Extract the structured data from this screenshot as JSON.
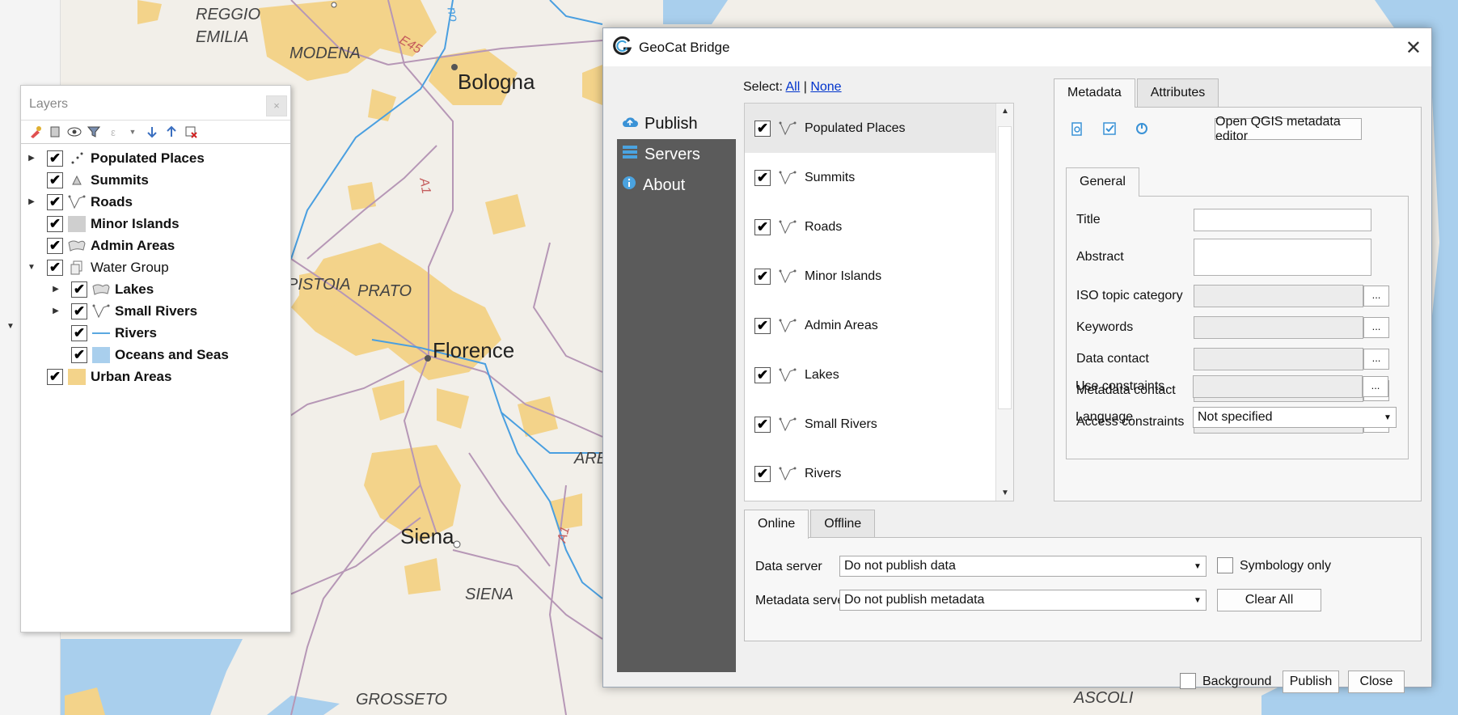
{
  "map": {
    "labels": [
      {
        "text": "REGGIO",
        "style": "it"
      },
      {
        "text": "EMILIA",
        "style": "it"
      },
      {
        "text": "MODENA",
        "style": "it"
      },
      {
        "text": "E45",
        "style": "road"
      },
      {
        "text": "Bologna",
        "style": "city"
      },
      {
        "text": "A1",
        "style": "road"
      },
      {
        "text": "PISTOIA",
        "style": "it"
      },
      {
        "text": "PRATO",
        "style": "it"
      },
      {
        "text": "Florence",
        "style": "city"
      },
      {
        "text": "AREZ",
        "style": "it"
      },
      {
        "text": "Siena",
        "style": "city"
      },
      {
        "text": "A1",
        "style": "road"
      },
      {
        "text": "SIENA",
        "style": "it"
      },
      {
        "text": "GROSSETO",
        "style": "it"
      },
      {
        "text": "ASCOLI",
        "style": "it"
      },
      {
        "text": "no",
        "style": "road"
      }
    ],
    "colors": {
      "land": "#f2efe9",
      "urban": "#f3d38a",
      "sea": "#a9cfed",
      "roads": "#b697b6",
      "rivers": "#4a9fe0"
    }
  },
  "layers_panel": {
    "title": "Layers",
    "close_label": "×",
    "toolbar_icons": [
      "style-manager-icon",
      "add-group-icon",
      "visibility-icon",
      "filter-icon",
      "expression-filter-icon",
      "expand-all-icon",
      "collapse-all-icon",
      "remove-layer-icon"
    ],
    "items": [
      {
        "name": "Populated Places",
        "expand": "▶",
        "symbol": "points",
        "bold": true,
        "checked": "✔"
      },
      {
        "name": "Summits",
        "expand": "",
        "symbol": "triangle",
        "bold": true,
        "checked": "✔"
      },
      {
        "name": "Roads",
        "expand": "▶",
        "symbol": "line",
        "bold": true,
        "checked": "✔"
      },
      {
        "name": "Minor Islands",
        "expand": "",
        "symbol": "grey-fill",
        "bold": true,
        "checked": "✔"
      },
      {
        "name": "Admin Areas",
        "expand": "",
        "symbol": "polygon",
        "bold": true,
        "checked": "✔"
      },
      {
        "name": "Water Group",
        "expand": "▼",
        "symbol": "group",
        "bold": false,
        "checked": "✔"
      },
      {
        "name": "Lakes",
        "expand": "▶",
        "symbol": "polygon",
        "bold": true,
        "checked": "✔",
        "indent": 1
      },
      {
        "name": "Small Rivers",
        "expand": "▶",
        "symbol": "line",
        "bold": true,
        "checked": "✔",
        "indent": 1
      },
      {
        "name": "Rivers",
        "expand": "",
        "symbol": "blue-line",
        "bold": true,
        "checked": "✔",
        "indent": 1
      },
      {
        "name": "Oceans and Seas",
        "expand": "",
        "symbol": "blue-fill",
        "bold": true,
        "checked": "✔",
        "indent": 1
      },
      {
        "name": "Urban Areas",
        "expand": "",
        "symbol": "yellow-fill",
        "bold": true,
        "checked": "✔"
      }
    ]
  },
  "bridge": {
    "title": "GeoCat Bridge",
    "close_label": "✕",
    "nav": [
      {
        "label": "Publish",
        "icon": "cloud-upload-icon",
        "active": true
      },
      {
        "label": "Servers",
        "icon": "servers-icon",
        "active": false
      },
      {
        "label": "About",
        "icon": "info-icon",
        "active": false
      }
    ],
    "select": {
      "prefix": "Select:",
      "all": "All",
      "separator": "|",
      "none": "None"
    },
    "layer_list": [
      {
        "name": "Populated Places",
        "checked": "✔"
      },
      {
        "name": "Summits",
        "checked": "✔"
      },
      {
        "name": "Roads",
        "checked": "✔"
      },
      {
        "name": "Minor Islands",
        "checked": "✔"
      },
      {
        "name": "Admin Areas",
        "checked": "✔"
      },
      {
        "name": "Lakes",
        "checked": "✔"
      },
      {
        "name": "Small Rivers",
        "checked": "✔"
      },
      {
        "name": "Rivers",
        "checked": "✔"
      }
    ],
    "meta_tabs": [
      "Metadata",
      "Attributes"
    ],
    "meta_icons": [
      "load-metadata-icon",
      "validate-metadata-icon",
      "preview-metadata-icon"
    ],
    "open_editor": "Open QGIS metadata editor",
    "general_tab": "General",
    "fields": {
      "title": "Title",
      "abstract": "Abstract",
      "iso": "ISO topic category",
      "keywords": "Keywords",
      "data_contact": "Data contact",
      "metadata_contact": "Metadata contact",
      "access": "Access constraints",
      "use": "Use constraints",
      "language": "Language"
    },
    "dots": "...",
    "language_value": "Not specified",
    "server_tabs": [
      "Online",
      "Offline"
    ],
    "data_server_label": "Data server",
    "data_server_value": "Do not publish data",
    "symbology_only": "Symbology only",
    "metadata_server_label": "Metadata server",
    "metadata_server_value": "Do not publish metadata",
    "clear_all": "Clear All",
    "background": "Background",
    "publish": "Publish",
    "close": "Close"
  }
}
